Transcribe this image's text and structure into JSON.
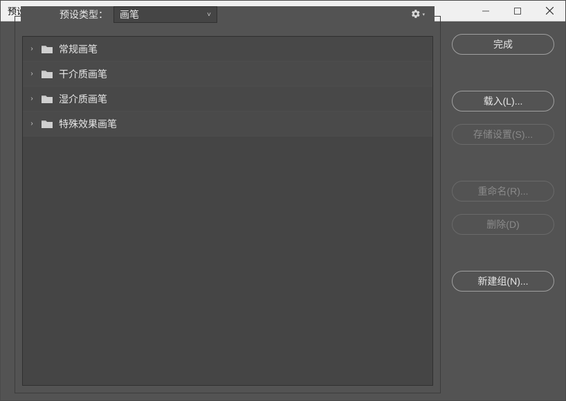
{
  "window": {
    "title": "预设管理器"
  },
  "header": {
    "preset_type_label": "预设类型：",
    "dropdown_value": "画笔"
  },
  "list": {
    "items": [
      {
        "label": "常规画笔"
      },
      {
        "label": "干介质画笔"
      },
      {
        "label": "湿介质画笔"
      },
      {
        "label": "特殊效果画笔"
      }
    ]
  },
  "buttons": {
    "done": "完成",
    "load": "载入(L)...",
    "save_set": "存储设置(S)...",
    "rename": "重命名(R)...",
    "delete": "删除(D)",
    "new_group": "新建组(N)..."
  }
}
